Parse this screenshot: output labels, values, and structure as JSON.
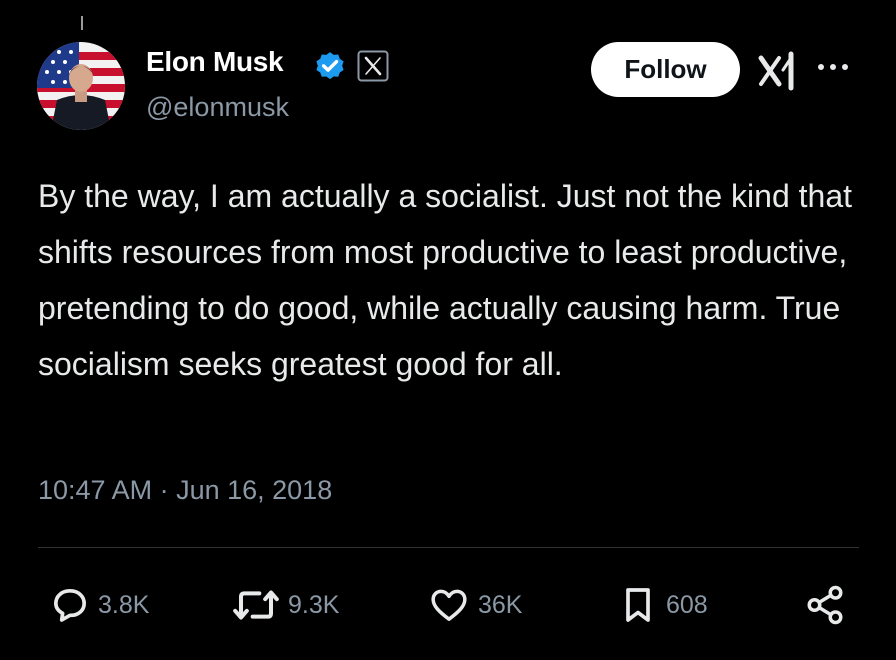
{
  "author": {
    "name": "Elon Musk",
    "handle": "@elonmusk"
  },
  "follow_label": "Follow",
  "tweet": {
    "text": "By the way, I am actually a socialist. Just not the kind that shifts resources from most productive to least productive, pretending to do good, while actually causing harm. True socialism seeks greatest good for all.",
    "timestamp": "10:47 AM · Jun 16, 2018"
  },
  "metrics": {
    "replies": "3.8K",
    "reposts": "9.3K",
    "likes": "36K",
    "bookmarks": "608"
  },
  "icons": {
    "verified": "verified-badge-icon",
    "x_logo": "x-logo-icon",
    "grok": "grok-icon",
    "more": "more-icon",
    "reply": "reply-icon",
    "repost": "repost-icon",
    "like": "like-icon",
    "bookmark": "bookmark-icon",
    "share": "share-icon"
  },
  "colors": {
    "background": "#000000",
    "text": "#e7e9ea",
    "muted": "#8b98a5",
    "verified": "#1d9bf0",
    "follow_bg": "#ffffff"
  }
}
